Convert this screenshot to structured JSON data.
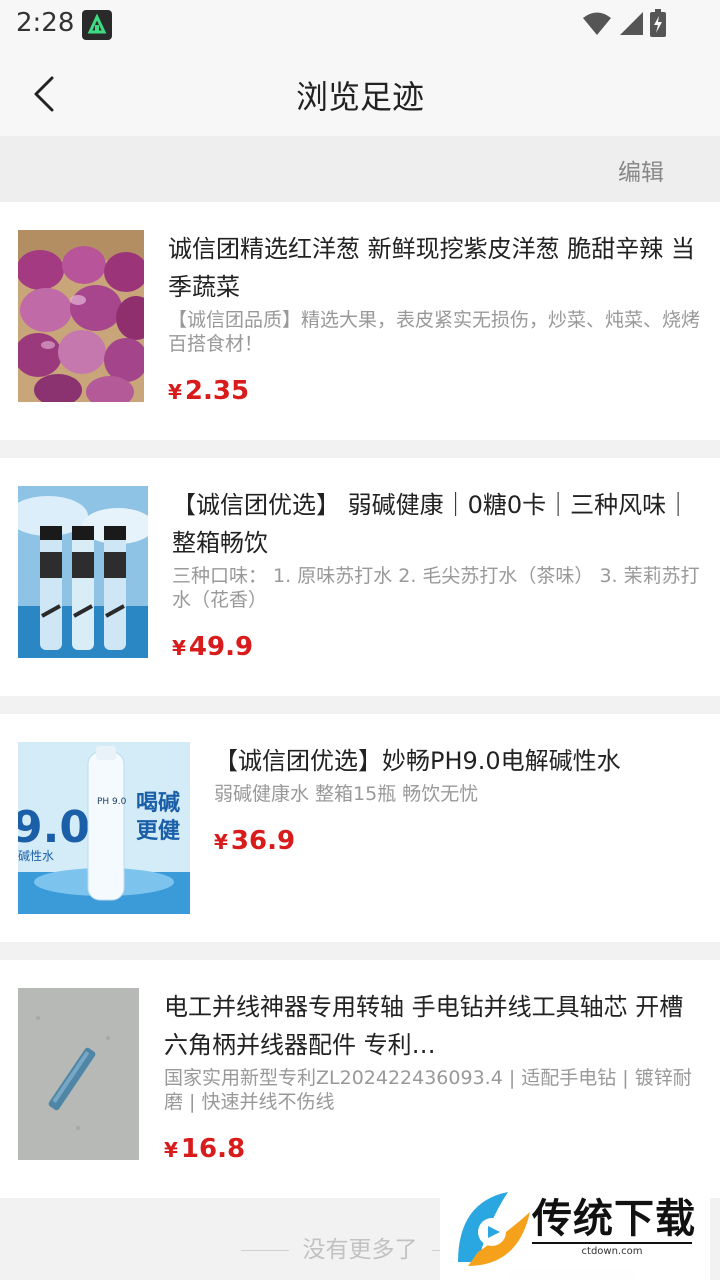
{
  "status": {
    "time": "2:28"
  },
  "header": {
    "title": "浏览足迹",
    "edit_label": "编辑"
  },
  "products": [
    {
      "title": "诚信团精选红洋葱 新鲜现挖紫皮洋葱 脆甜辛辣 当季蔬菜",
      "desc": "【诚信团品质】精选大果，表皮紧实无损伤，炒菜、炖菜、烧烤百搭食材！",
      "currency": "¥",
      "price": "2.35"
    },
    {
      "title": "【诚信团优选】 弱碱健康｜0糖0卡｜三种风味｜整箱畅饮",
      "desc": "三种口味： 1. 原味苏打水 2. 毛尖苏打水（茶味） 3. 茉莉苏打水（花香）",
      "currency": "¥",
      "price": "49.9"
    },
    {
      "title": "【诚信团优选】妙畅PH9.0电解碱性水",
      "desc": "弱碱健康水 整箱15瓶 畅饮无忧",
      "currency": "¥",
      "price": "36.9",
      "image_text": {
        "big": "9.0",
        "side": "碱性水",
        "bottle": "PH 9.0",
        "slogan1": "喝碱",
        "slogan2": "更健"
      }
    },
    {
      "title": "电工并线神器专用转轴 手电钻并线工具轴芯 开槽六角柄并线器配件 专利…",
      "desc": "国家实用新型专利ZL202422436093.4 | 适配手电钻 | 镀锌耐磨 | 快速并线不伤线",
      "currency": "¥",
      "price": "16.8"
    }
  ],
  "footer": {
    "text": "没有更多了"
  },
  "watermark": {
    "text": "传统下载",
    "sub": "ctdown.com"
  }
}
